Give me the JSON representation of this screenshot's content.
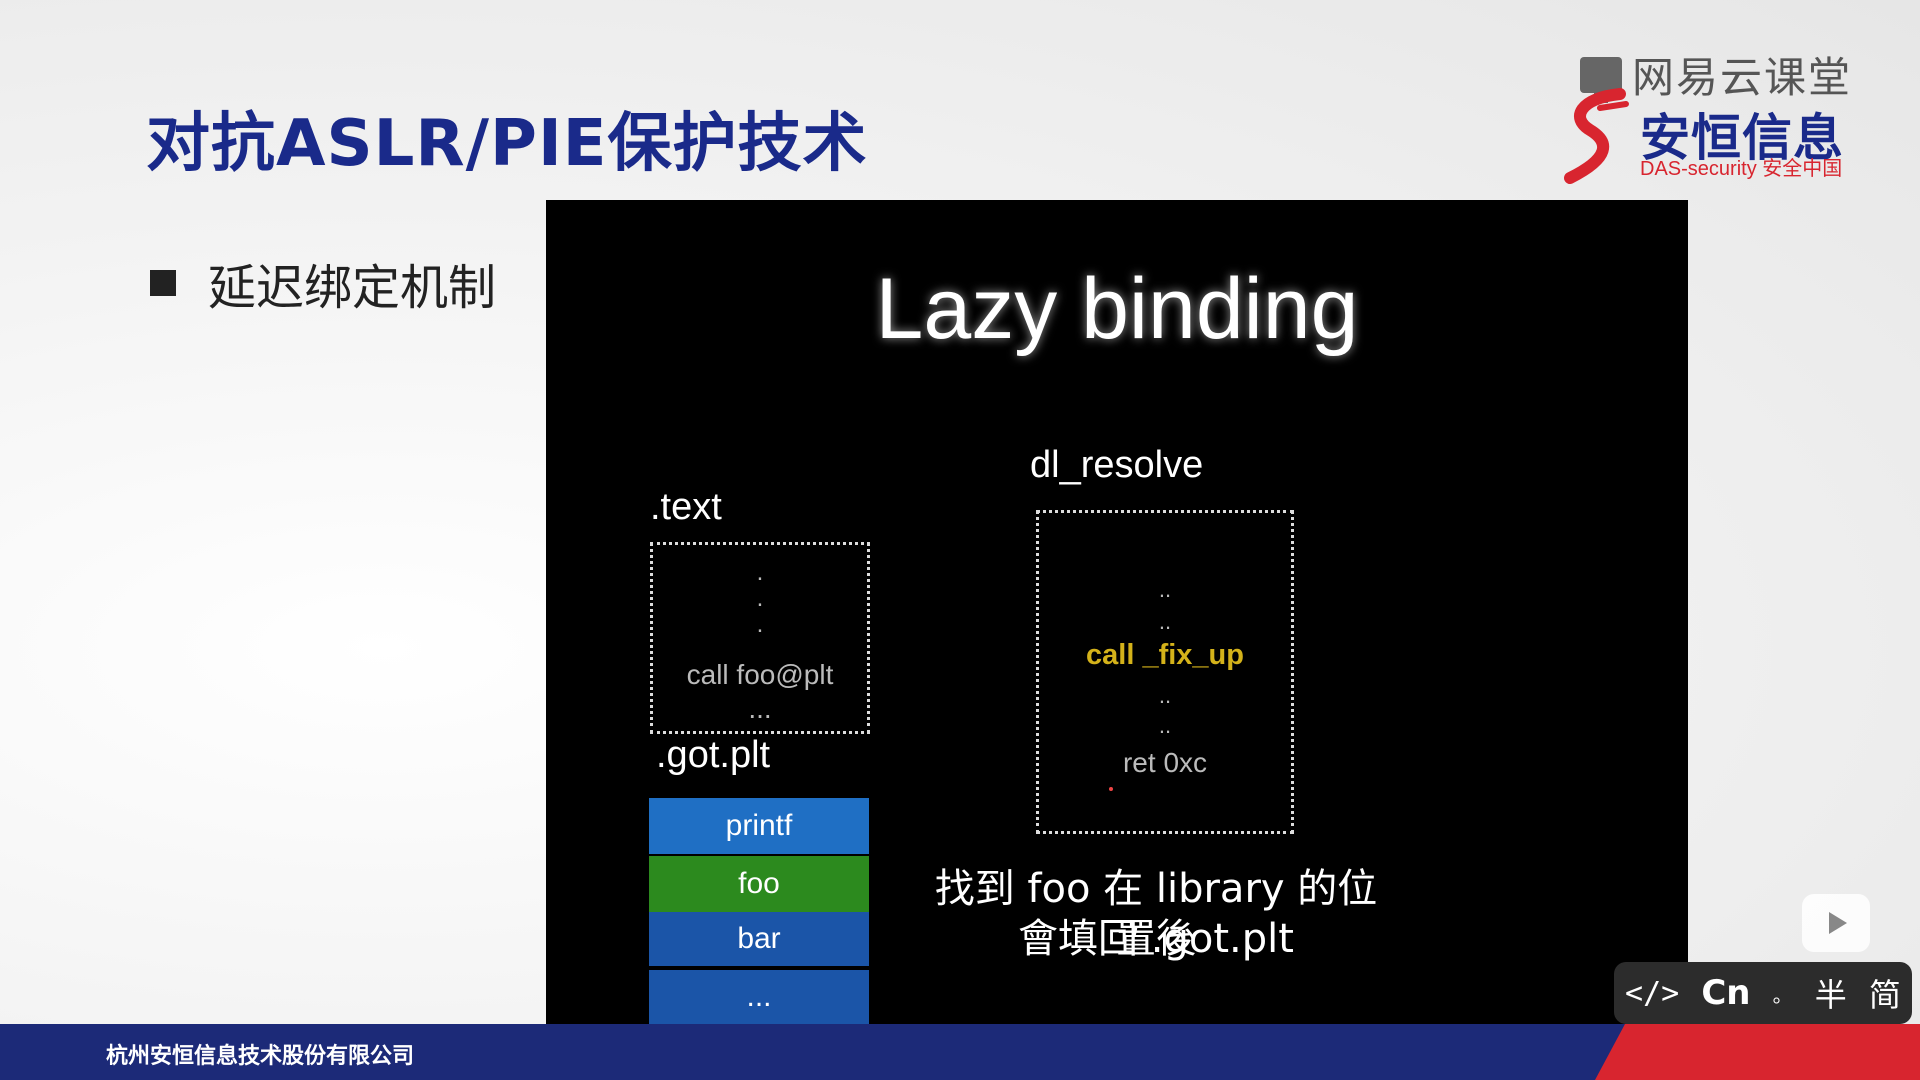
{
  "slide": {
    "title": "对抗ASLR/PIE保护技术",
    "bullet": "延迟绑定机制"
  },
  "logo": {
    "top_text": "网易云课堂",
    "main_text": "安恒信息",
    "sub_text": "DAS-security 安全中国"
  },
  "diagram": {
    "title": "Lazy binding",
    "text_label": ".text",
    "text_box_dots": [
      ".",
      ".",
      "."
    ],
    "text_box_call": "call foo@plt",
    "text_box_ellipsis": "...",
    "gotplt_label": ".got.plt",
    "gotplt_rows": [
      "printf",
      "foo",
      "bar",
      "..."
    ],
    "resolve_label": "dl_resolve",
    "resolve_dots_top": [
      "..",
      ".."
    ],
    "resolve_call": "call _fix_up",
    "resolve_dots_bottom": [
      "..",
      ".."
    ],
    "resolve_ret": "ret 0xc",
    "note_line1": "找到 foo 在 library 的位置後",
    "note_line2": "會填回 .got.plt"
  },
  "footer": {
    "company": "杭州安恒信息技术股份有限公司"
  },
  "toolbar": {
    "code_label": "</>",
    "cn_label": "Cn",
    "dot_label": "。",
    "half_label": "半",
    "simplified_label": "简"
  },
  "colors": {
    "title_blue": "#1a2a8a",
    "brand_red": "#d8252f",
    "printf_row": "#1f6fc4",
    "foo_row": "#2c8a1e",
    "bar_row": "#1b55a8",
    "call_yellow": "#d4b21a"
  },
  "icons": [
    "screen-icon",
    "logo-mark-icon",
    "play-icon"
  ]
}
